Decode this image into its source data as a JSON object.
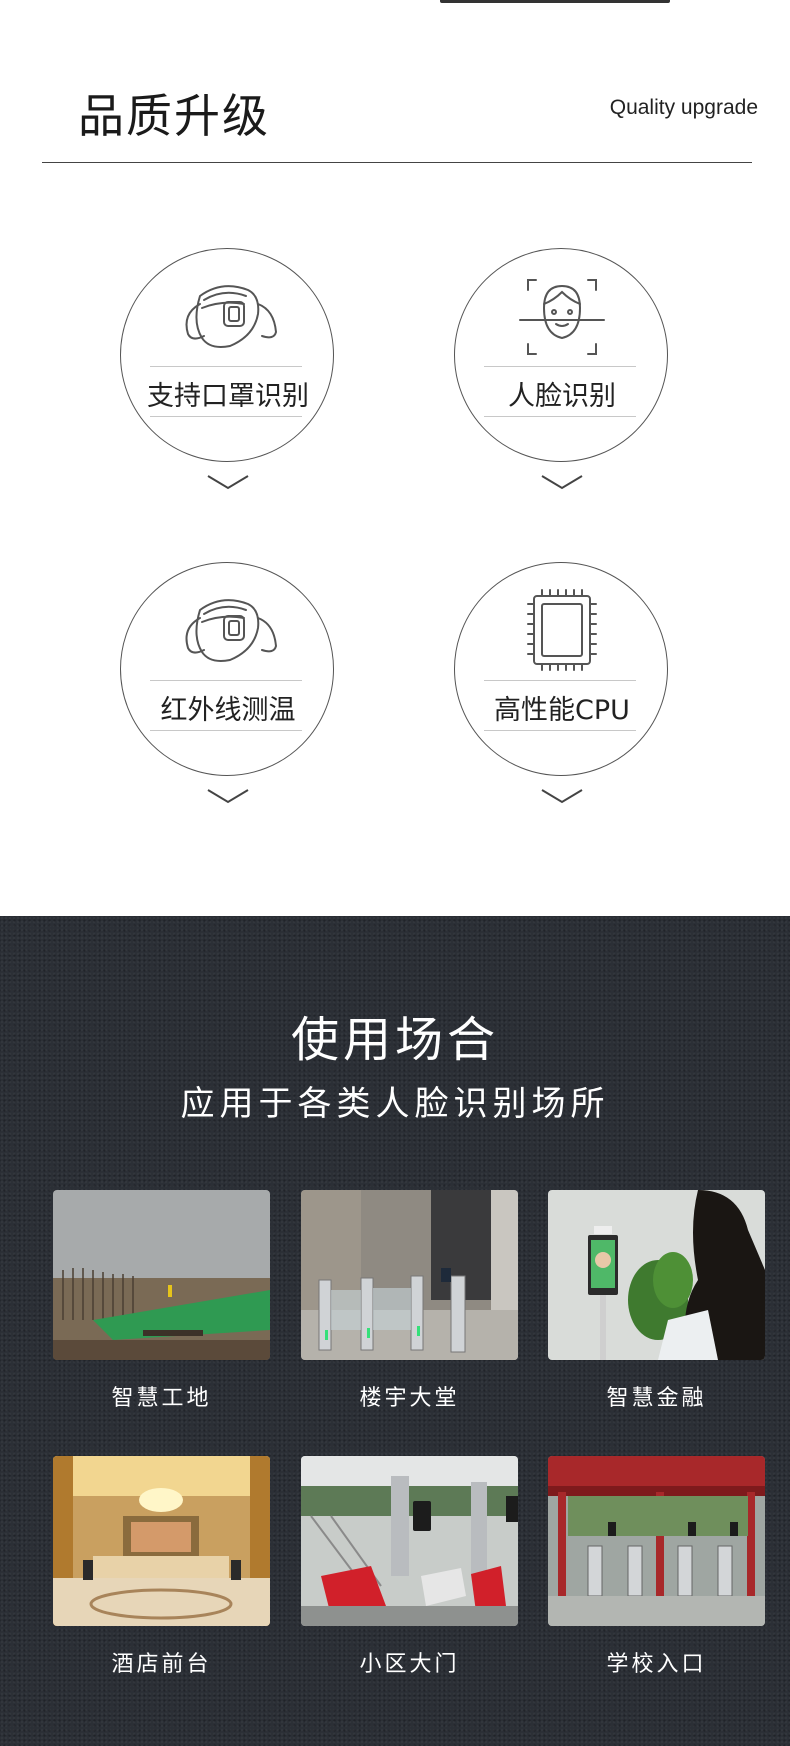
{
  "quality": {
    "title": "品质升级",
    "subtitle": "Quality upgrade",
    "features": [
      {
        "label": "支持口罩识别",
        "icon": "mask-icon"
      },
      {
        "label": "人脸识别",
        "icon": "face-scan-icon"
      },
      {
        "label": "红外线测温",
        "icon": "mask-icon"
      },
      {
        "label": "高性能CPU",
        "icon": "cpu-chip-icon"
      }
    ]
  },
  "usage": {
    "title": "使用场合",
    "subtitle": "应用于各类人脸识别场所",
    "scenes": [
      {
        "label": "智慧工地"
      },
      {
        "label": "楼宇大堂"
      },
      {
        "label": "智慧金融"
      },
      {
        "label": "酒店前台"
      },
      {
        "label": "小区大门"
      },
      {
        "label": "学校入口"
      }
    ]
  },
  "colors": {
    "dark_bg": "#2b2f36",
    "text_dark": "#1a1a1a",
    "text_light": "#ffffff"
  }
}
